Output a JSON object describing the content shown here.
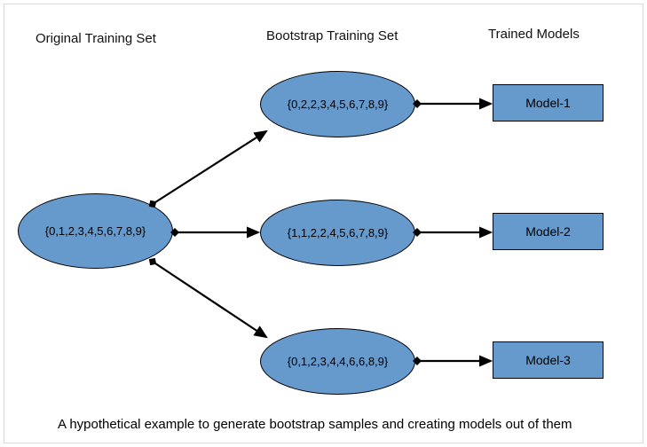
{
  "headings": {
    "original": "Original Training Set",
    "bootstrap": "Bootstrap Training Set",
    "trained": "Trained Models"
  },
  "original_set": "{0,1,2,3,4,5,6,7,8,9}",
  "bootstrap_sets": {
    "b1": "{0,2,2,3,4,5,6,7,8,9}",
    "b2": "{1,1,2,2,4,5,6,7,8,9}",
    "b3": "{0,1,2,3,4,4,6,6,8,9}"
  },
  "models": {
    "m1": "Model-1",
    "m2": "Model-2",
    "m3": "Model-3"
  },
  "caption": "A hypothetical example to generate bootstrap samples and creating models out of them"
}
